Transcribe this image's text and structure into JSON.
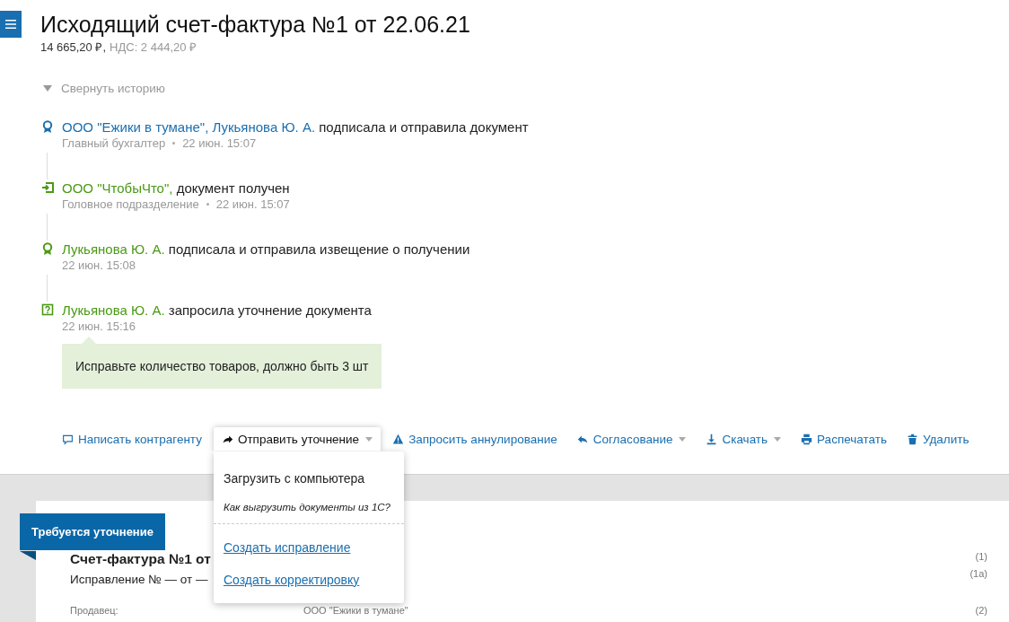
{
  "header": {
    "title": "Исходящий счет-фактура №1 от 22.06.21",
    "amount": "14 665,20 ₽,",
    "vat": "НДС: 2 444,20 ₽"
  },
  "history": {
    "toggle": "Свернуть историю",
    "expanded": true,
    "events": [
      {
        "kind": "sign",
        "color": "#1a6fb0",
        "actor": "ООО \"Ежики в тумане\", Лукьянова Ю. А.",
        "action": "подписала и отправила документ",
        "meta": [
          "Главный бухгалтер",
          "22 июн. 15:07"
        ]
      },
      {
        "kind": "receive",
        "color": "#4a9a14",
        "actor": "ООО \"ЧтобыЧто\",",
        "action": "документ получен",
        "meta": [
          "Головное подразделение",
          "22 июн. 15:07"
        ]
      },
      {
        "kind": "sign",
        "color": "#4a9a14",
        "actor": "Лукьянова Ю. А.",
        "action": "подписала и отправила извещение о получении",
        "meta": [
          "22 июн. 15:08"
        ]
      },
      {
        "kind": "question",
        "color": "#4a9a14",
        "actor": "Лукьянова Ю. А.",
        "action": "запросила уточнение документа",
        "meta": [
          "22 июн. 15:16"
        ],
        "comment": "Исправьте количество товаров, должно быть 3 шт"
      }
    ]
  },
  "actions": [
    {
      "kind": "comment",
      "label": "Написать контрагенту",
      "caret": false,
      "open": false
    },
    {
      "kind": "forward",
      "label": "Отправить уточнение",
      "caret": true,
      "open": true
    },
    {
      "kind": "warning",
      "label": "Запросить аннулирование",
      "caret": false,
      "open": false
    },
    {
      "kind": "reply",
      "label": "Согласование",
      "caret": true,
      "open": false
    },
    {
      "kind": "download",
      "label": "Скачать",
      "caret": true,
      "open": false
    },
    {
      "kind": "print",
      "label": "Распечатать",
      "caret": false,
      "open": false
    },
    {
      "kind": "delete",
      "label": "Удалить",
      "caret": false,
      "open": false
    }
  ],
  "menu": [
    {
      "kind": "action",
      "label": "Загрузить с компьютера"
    },
    {
      "kind": "hint",
      "label": "Как выгрузить документы из 1С?"
    },
    {
      "kind": "divider"
    },
    {
      "kind": "link",
      "label": "Создать исправление"
    },
    {
      "kind": "link",
      "label": "Создать корректировку"
    }
  ],
  "document": {
    "status": "Требуется уточнение",
    "title": "Счет-фактура №1 от",
    "correction": "Исправление № — от —",
    "lines": [
      {
        "code": "(1)"
      },
      {
        "code": "(1а)"
      },
      {
        "label": "Продавец:",
        "value": "ООО \"Ежики в тумане\"",
        "code": "(2)"
      }
    ]
  }
}
